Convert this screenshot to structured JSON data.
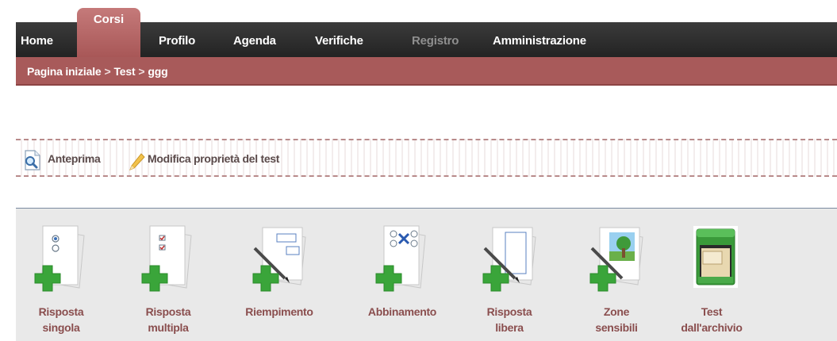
{
  "nav": {
    "home": "Home",
    "corsi": "Corsi",
    "profilo": "Profilo",
    "agenda": "Agenda",
    "verifiche": "Verifiche",
    "registro": "Registro",
    "amministrazione": "Amministrazione"
  },
  "breadcrumb": {
    "items": [
      "Pagina iniziale",
      "Test",
      "ggg"
    ],
    "separator": ">"
  },
  "actions": {
    "preview": "Anteprima",
    "edit": "Modifica proprietà del test"
  },
  "tools": [
    {
      "line1": "Risposta",
      "line2": "singola"
    },
    {
      "line1": "Risposta",
      "line2": "multipla"
    },
    {
      "line1": "Riempimento",
      "line2": ""
    },
    {
      "line1": "Abbinamento",
      "line2": ""
    },
    {
      "line1": "Risposta",
      "line2": "libera"
    },
    {
      "line1": "Zone",
      "line2": "sensibili"
    },
    {
      "line1": "Test",
      "line2": "dall'archivio"
    }
  ],
  "colors": {
    "accent": "#a85a5a",
    "nav_bg": "#2b2b2b",
    "tool_label": "#8a4e4e",
    "plus_green": "#3aa53a"
  }
}
